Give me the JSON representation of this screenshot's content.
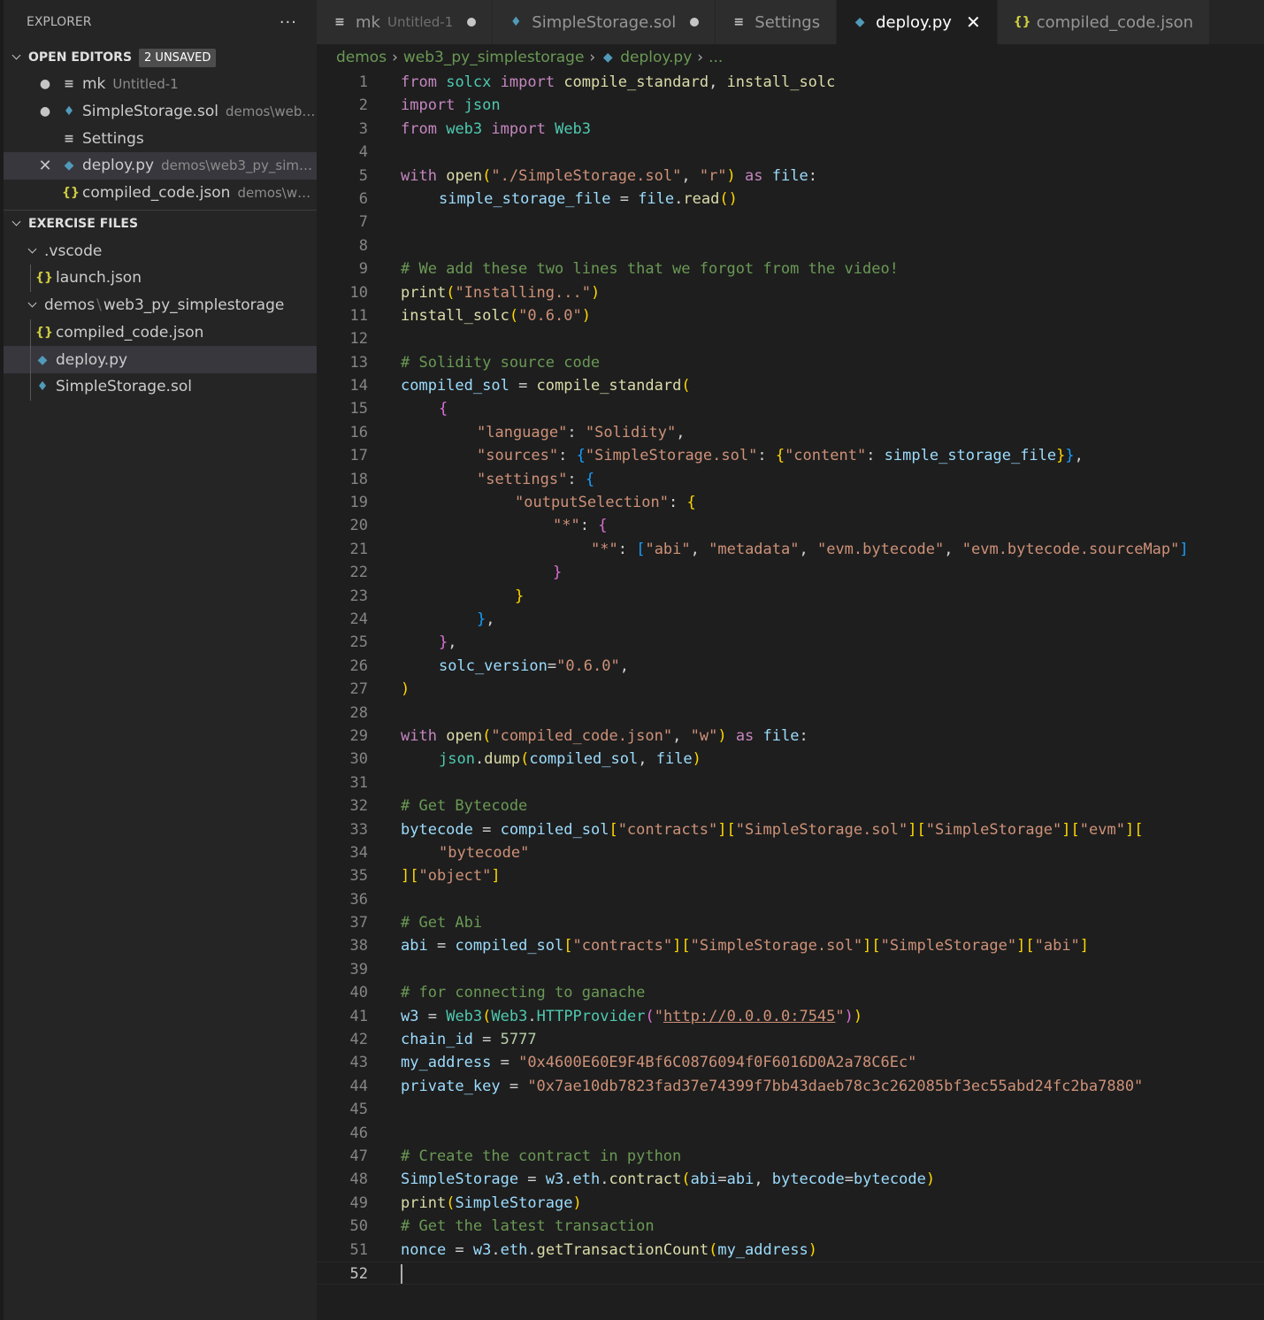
{
  "explorer": {
    "title": "EXPLORER",
    "more": "···",
    "open_editors": {
      "label": "OPEN EDITORS",
      "badge": "2 UNSAVED",
      "items": [
        {
          "name": "mk",
          "desc": "Untitled-1"
        },
        {
          "name": "SimpleStorage.sol",
          "desc": "demos\\web3_..."
        },
        {
          "name": "Settings",
          "desc": ""
        },
        {
          "name": "deploy.py",
          "desc": "demos\\web3_py_simpl..."
        },
        {
          "name": "compiled_code.json",
          "desc": "demos\\web..."
        }
      ]
    },
    "exercise_files": {
      "label": "EXERCISE FILES",
      "vscode_folder": ".vscode",
      "launch": "launch.json",
      "demos_folder": "demos",
      "sub_folder": "web3_py_simplestorage",
      "files": [
        "compiled_code.json",
        "deploy.py",
        "SimpleStorage.sol"
      ]
    }
  },
  "tabs": [
    {
      "name": "mk",
      "sub": "Untitled-1"
    },
    {
      "name": "SimpleStorage.sol"
    },
    {
      "name": "Settings"
    },
    {
      "name": "deploy.py"
    },
    {
      "name": "compiled_code.json"
    }
  ],
  "breadcrumb": {
    "a": "demos",
    "b": "web3_py_simplestorage",
    "c": "deploy.py",
    "d": "..."
  },
  "editor": {
    "line_numbers": [
      "1",
      "2",
      "3",
      "4",
      "5",
      "6",
      "7",
      "8",
      "9",
      "10",
      "11",
      "12",
      "13",
      "14",
      "15",
      "16",
      "17",
      "18",
      "19",
      "20",
      "21",
      "22",
      "23",
      "24",
      "25",
      "26",
      "27",
      "28",
      "29",
      "30",
      "31",
      "32",
      "33",
      "34",
      "35",
      "36",
      "37",
      "38",
      "39",
      "40",
      "41",
      "42",
      "43",
      "44",
      "45",
      "46",
      "47",
      "48",
      "49",
      "50",
      "51",
      "52"
    ],
    "t": {
      "from": "from",
      "import": "import",
      "with": "with",
      "as": "as",
      "solcx": "solcx",
      "web3": "web3",
      "Web3": "Web3",
      "json": "json",
      "compile_standard": "compile_standard",
      "install_solc": "install_solc",
      "open": "open",
      "print": "print",
      "read": "read",
      "dump": "dump",
      "contract": "contract",
      "HTTPProvider": "HTTPProvider",
      "getTransactionCount": "getTransactionCount",
      "file": "file",
      "simple_storage_file": "simple_storage_file",
      "compiled_sol": "compiled_sol",
      "bytecode": "bytecode",
      "abi": "abi",
      "w3": "w3",
      "eth": "eth",
      "chain_id": "chain_id",
      "my_address": "my_address",
      "private_key": "private_key",
      "SimpleStorage": "SimpleStorage",
      "nonce": "nonce",
      "solc_version": "solc_version",
      "comma_sp": ", ",
      "comma": ",",
      "eq": " = ",
      "eqs": "=",
      "dot": ".",
      "colon": ":",
      "colon_sp": ": ",
      "sp": " ",
      "lp": "(",
      "rp": ")",
      "lb": "{",
      "rb": "}",
      "lsq": "[",
      "rsq": "]",
      "rp_comma": "),",
      "rb_comma": "},",
      "s_sol_path": "\"./SimpleStorage.sol\"",
      "s_r": "\"r\"",
      "s_w": "\"w\"",
      "s_installing": "\"Installing...\"",
      "s_060": "\"0.6.0\"",
      "s_language": "\"language\"",
      "s_Solidity": "\"Solidity\"",
      "s_sources": "\"sources\"",
      "s_SimpleStorage_sol": "\"SimpleStorage.sol\"",
      "s_content": "\"content\"",
      "s_settings": "\"settings\"",
      "s_outputSelection": "\"outputSelection\"",
      "s_star": "\"*\"",
      "s_abi": "\"abi\"",
      "s_metadata": "\"metadata\"",
      "s_evm_bytecode": "\"evm.bytecode\"",
      "s_evm_bytecode_sourceMap": "\"evm.bytecode.sourceMap\"",
      "s_compiled_code_json": "\"compiled_code.json\"",
      "s_contracts": "\"contracts\"",
      "s_SimpleStorage": "\"SimpleStorage\"",
      "s_evm": "\"evm\"",
      "s_bytecode": "\"bytecode\"",
      "s_object": "\"object\"",
      "q": "\"",
      "url": "http://0.0.0.0:7545",
      "n5777": "5777",
      "s_addr": "\"0x4600E60E9F4Bf6C0876094f0F6016D0A2a78C6Ec\"",
      "s_key": "\"0x7ae10db7823fad37e74399f7bb43daeb78c3c262085bf3ec55abd24fc2ba7880\"",
      "kw_abi": "abi",
      "kw_bytecode": "bytecode",
      "c1": "# We add these two lines that we forgot from the video!",
      "c2": "# Solidity source code",
      "c3": "# Get Bytecode",
      "c4": "# Get Abi",
      "c5": "# for connecting to ganache",
      "c6": "# Create the contract in python",
      "c7": "# Get the latest transaction"
    }
  },
  "colors": {
    "background": "#1e1e1e",
    "sidebar": "#252526",
    "keyword": "#c586c0",
    "string": "#ce9178",
    "function": "#dcdcaa",
    "variable": "#9cdcfe",
    "comment": "#6a9955"
  }
}
